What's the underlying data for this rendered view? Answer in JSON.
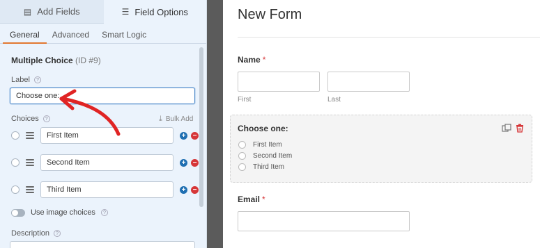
{
  "tabs": [
    {
      "label": "Add Fields",
      "icon": "list-icon"
    },
    {
      "label": "Field Options",
      "icon": "sliders-icon"
    }
  ],
  "subtabs": [
    "General",
    "Advanced",
    "Smart Logic"
  ],
  "field": {
    "name": "Multiple Choice",
    "id": "(ID #9)"
  },
  "label_section": {
    "label": "Label",
    "value": "Choose one:"
  },
  "choices_section": {
    "label": "Choices",
    "bulk_add": "Bulk Add",
    "items": [
      "First Item",
      "Second Item",
      "Third Item"
    ]
  },
  "image_choices": {
    "label": "Use image choices",
    "enabled": false
  },
  "description": {
    "label": "Description"
  },
  "preview": {
    "title": "New Form",
    "name_field": {
      "label": "Name",
      "required": "*",
      "first": "First",
      "last": "Last"
    },
    "choice_field": {
      "label": "Choose one:",
      "options": [
        "First Item",
        "Second Item",
        "Third Item"
      ]
    },
    "email_field": {
      "label": "Email",
      "required": "*"
    }
  },
  "colors": {
    "accent": "#e27730",
    "arrow": "#e02424",
    "add": "#1f6fb2",
    "remove": "#d63638",
    "panel": "#ebf3fc"
  }
}
